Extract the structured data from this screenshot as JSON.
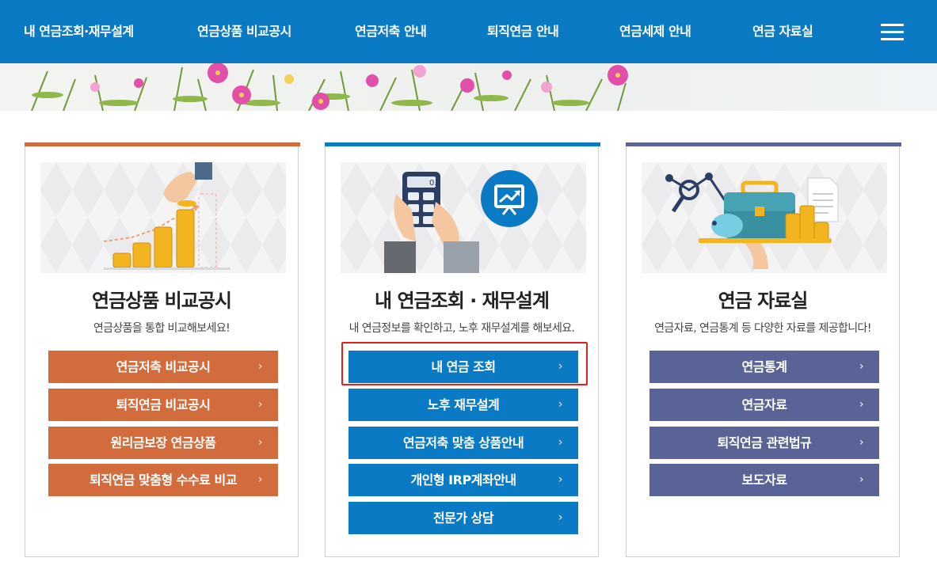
{
  "nav": {
    "items": [
      "내 연금조회·재무설계",
      "연금상품 비교공시",
      "연금저축 안내",
      "퇴직연금 안내",
      "연금세제 안내",
      "연금 자료실"
    ],
    "menu_icon": "hamburger-menu-icon"
  },
  "cards": [
    {
      "title": "연금상품 비교공시",
      "desc": "연금상품을 통합 비교해보세요!",
      "color": "#d26c3c",
      "buttons": [
        "연금저축 비교공시",
        "퇴직연금 비교공시",
        "원리금보장 연금상품",
        "퇴직연금 맞춤형 수수료 비교"
      ]
    },
    {
      "title": "내 연금조회 · 재무설계",
      "desc": "내 연금정보를 확인하고, 노후 재무설계를 해보세요.",
      "color": "#0b7ac4",
      "buttons": [
        "내 연금 조회",
        "노후 재무설계",
        "연금저축 맞춤 상품안내",
        "개인형 IRP계좌안내",
        "전문가 상담"
      ]
    },
    {
      "title": "연금 자료실",
      "desc": "연금자료, 연금통계 등 다양한 자료를 제공합니다!",
      "color": "#5a6396",
      "buttons": [
        "연금통계",
        "연금자료",
        "퇴직연금 관련법규",
        "보도자료"
      ]
    }
  ],
  "chevron": "›",
  "calculator_display": "0.",
  "highlight_color": "#e51f1f"
}
